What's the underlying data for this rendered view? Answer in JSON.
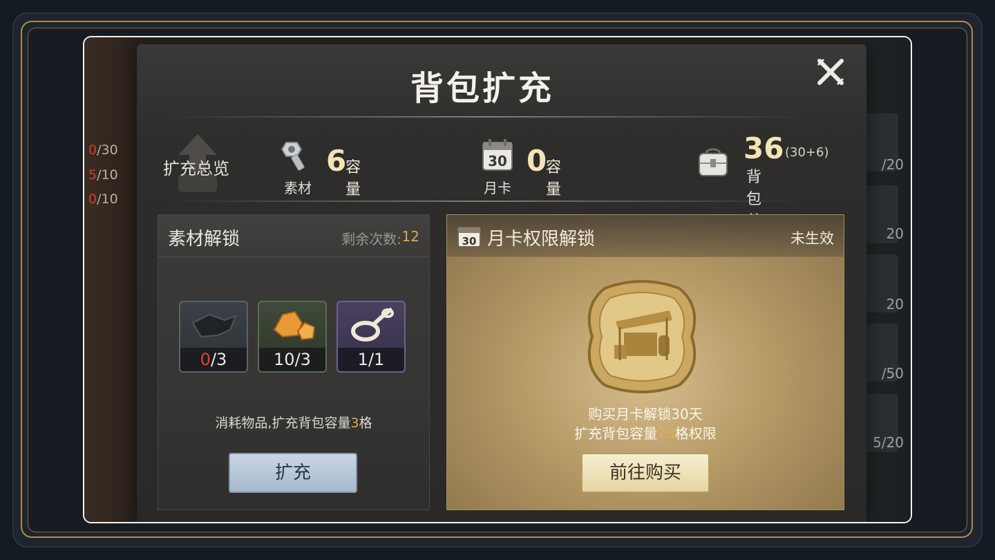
{
  "modal": {
    "title": "背包扩充",
    "close_icon": "close-x-icon"
  },
  "summary": {
    "overview_label": "扩充总览",
    "material": {
      "label": "素材",
      "value": "6",
      "unit": "容量",
      "icon": "bolt-nut-icon"
    },
    "monthly_card": {
      "label": "月卡",
      "value": "0",
      "unit": "容量",
      "icon": "calendar-icon",
      "calendar_day": "30"
    },
    "total": {
      "value": "36",
      "breakdown": "(30+6)",
      "label": "背包总容量",
      "icon": "backpack-icon"
    }
  },
  "material_panel": {
    "title": "素材解锁",
    "remaining_label": "剩余次数:",
    "remaining_value": "12",
    "items": [
      {
        "name": "dark-cloth",
        "have": "0",
        "need": "3",
        "insufficient": true
      },
      {
        "name": "amber-ore",
        "have": "10",
        "need": "3",
        "insufficient": false
      },
      {
        "name": "rope",
        "have": "1",
        "need": "1",
        "insufficient": false
      }
    ],
    "slash": "/",
    "description_prefix": "消耗物品,扩充背包容量",
    "description_value": "3",
    "description_suffix": "格",
    "button_label": "扩充"
  },
  "monthly_panel": {
    "title": "月卡权限解锁",
    "status": "未生效",
    "calendar_day": "30",
    "line1": "购买月卡解锁30天",
    "line2_prefix": "扩充背包容量",
    "line2_value": "18",
    "line2_suffix": "格权限",
    "button_label": "前往购买"
  },
  "background": {
    "left_counters": [
      {
        "have": "0",
        "rest": "/30"
      },
      {
        "have": "5",
        "rest": "/10"
      },
      {
        "have": "0",
        "rest": "/10"
      }
    ],
    "right_counters": [
      "/20",
      "20",
      "20",
      "/50",
      "5/20"
    ]
  },
  "colors": {
    "accent_orange": "#e6a84a",
    "insufficient_red": "#e0413a",
    "frame_gold": "#b8884e"
  }
}
